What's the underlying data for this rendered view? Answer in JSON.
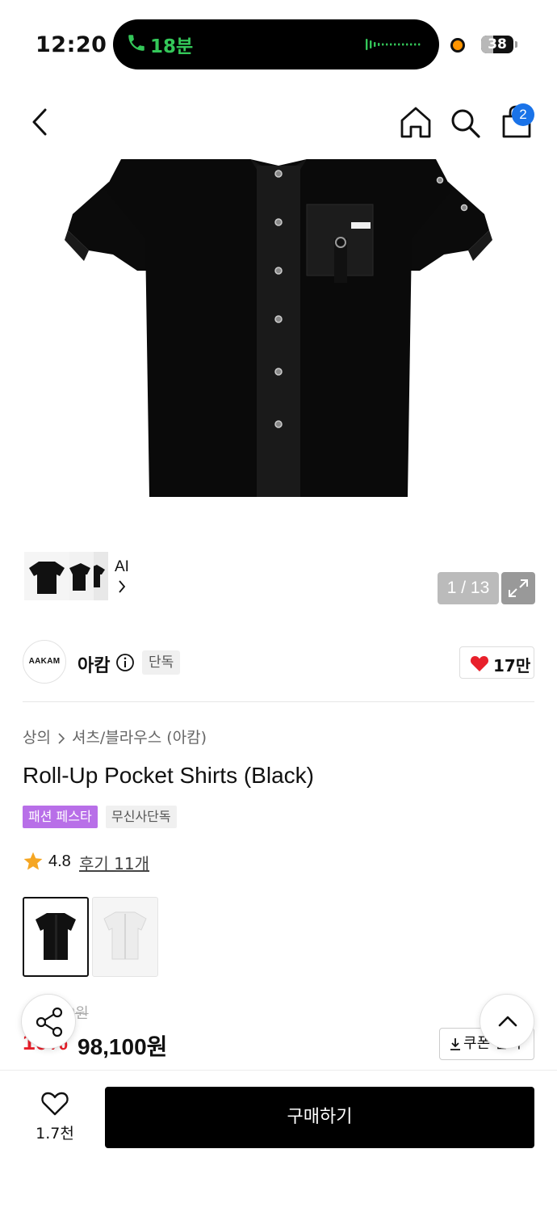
{
  "status_bar": {
    "time": "12:20",
    "call_duration": "18분",
    "battery": "38",
    "battery_level": 0.38
  },
  "gallery": {
    "ai_label": "AI",
    "counter": "1 / 13",
    "cart_count": "2"
  },
  "brand": {
    "logo_text": "AAKAM",
    "name": "아캄",
    "exclusive_tag": "단독",
    "likes": "17만"
  },
  "product": {
    "breadcrumb": [
      "상의",
      "셔츠/블라우스 (아캄)"
    ],
    "title": "Roll-Up Pocket Shirts (Black)",
    "tags": [
      "패션 페스타",
      "무신사단독"
    ],
    "rating": "4.8",
    "review_link": "후기 11개",
    "colors": [
      "black",
      "white"
    ],
    "original_price": "109,000원",
    "discount": "10%",
    "sale_price": "98,100원",
    "coupon_label": "쿠폰 받기"
  },
  "bottom_bar": {
    "wishlist_count": "1.7천",
    "buy_label": "구매하기"
  },
  "colors": {
    "accent_badge": "#1a73e8",
    "discount_red": "#e8202b",
    "festa_purple": "#b86fe8",
    "call_green": "#34c759"
  }
}
